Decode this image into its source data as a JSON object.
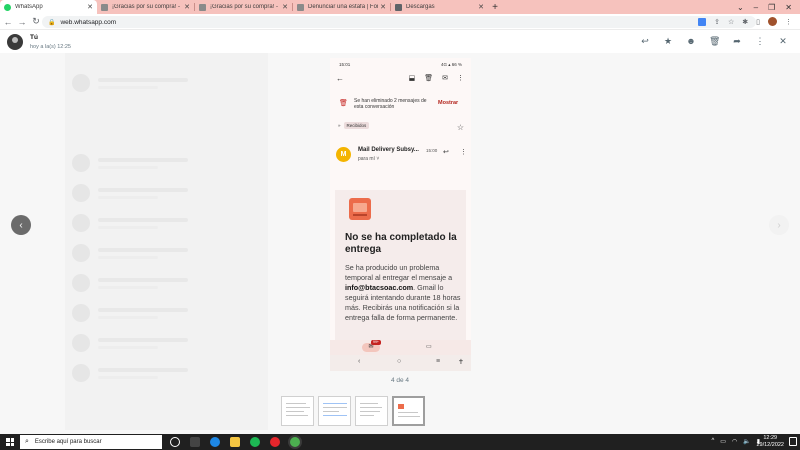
{
  "browser": {
    "tabs": [
      {
        "title": "WhatsApp",
        "favicon": "whatsapp-icon",
        "active": true
      },
      {
        "title": "¡Gracias por su compra! - btacso",
        "favicon": "document-icon",
        "active": false
      },
      {
        "title": "¡Gracias por su compra! - btacso",
        "favicon": "document-icon",
        "active": false
      },
      {
        "title": "Denunciar una estafa | Formulario",
        "favicon": "document-icon",
        "active": false
      },
      {
        "title": "Descargas",
        "favicon": "download-icon",
        "active": false
      }
    ],
    "new_tab": "+",
    "url": "web.whatsapp.com",
    "colors": {
      "tab_strip": "#f6c2bd",
      "omnibox": "#f1f3f4"
    }
  },
  "viewer": {
    "contact_name": "Tú",
    "timestamp": "hoy a la(s) 12:25",
    "counter": "4 de 4",
    "prev_glyph": "‹",
    "next_glyph": "›"
  },
  "phone": {
    "status_time": "15:01",
    "status_right": "4G ▴ 66 %",
    "banner_text": "Se han eliminado 2 mensajes de esta conversación",
    "banner_action": "Mostrar",
    "label_prefix": "»",
    "label_chip": "Recibidos",
    "sender_initial": "M",
    "sender_name": "Mail Delivery Subsy...",
    "sender_time": "15:00",
    "sender_to": "para mí ˅",
    "title": "No se ha completado la entrega",
    "body_pre": "Se ha producido un problema temporal al entregar el mensaje a",
    "body_email": "info@btacsoac.com",
    "body_post": ". Gmail lo seguirá intentando durante 18 horas más. Recibirás una notificación si la entrega falla de forma permanente.",
    "badge": "99+",
    "accent": "#c5221f"
  },
  "taskbar": {
    "search_placeholder": "Escribe aquí para buscar",
    "time": "12:29",
    "date": "29/12/2022"
  }
}
